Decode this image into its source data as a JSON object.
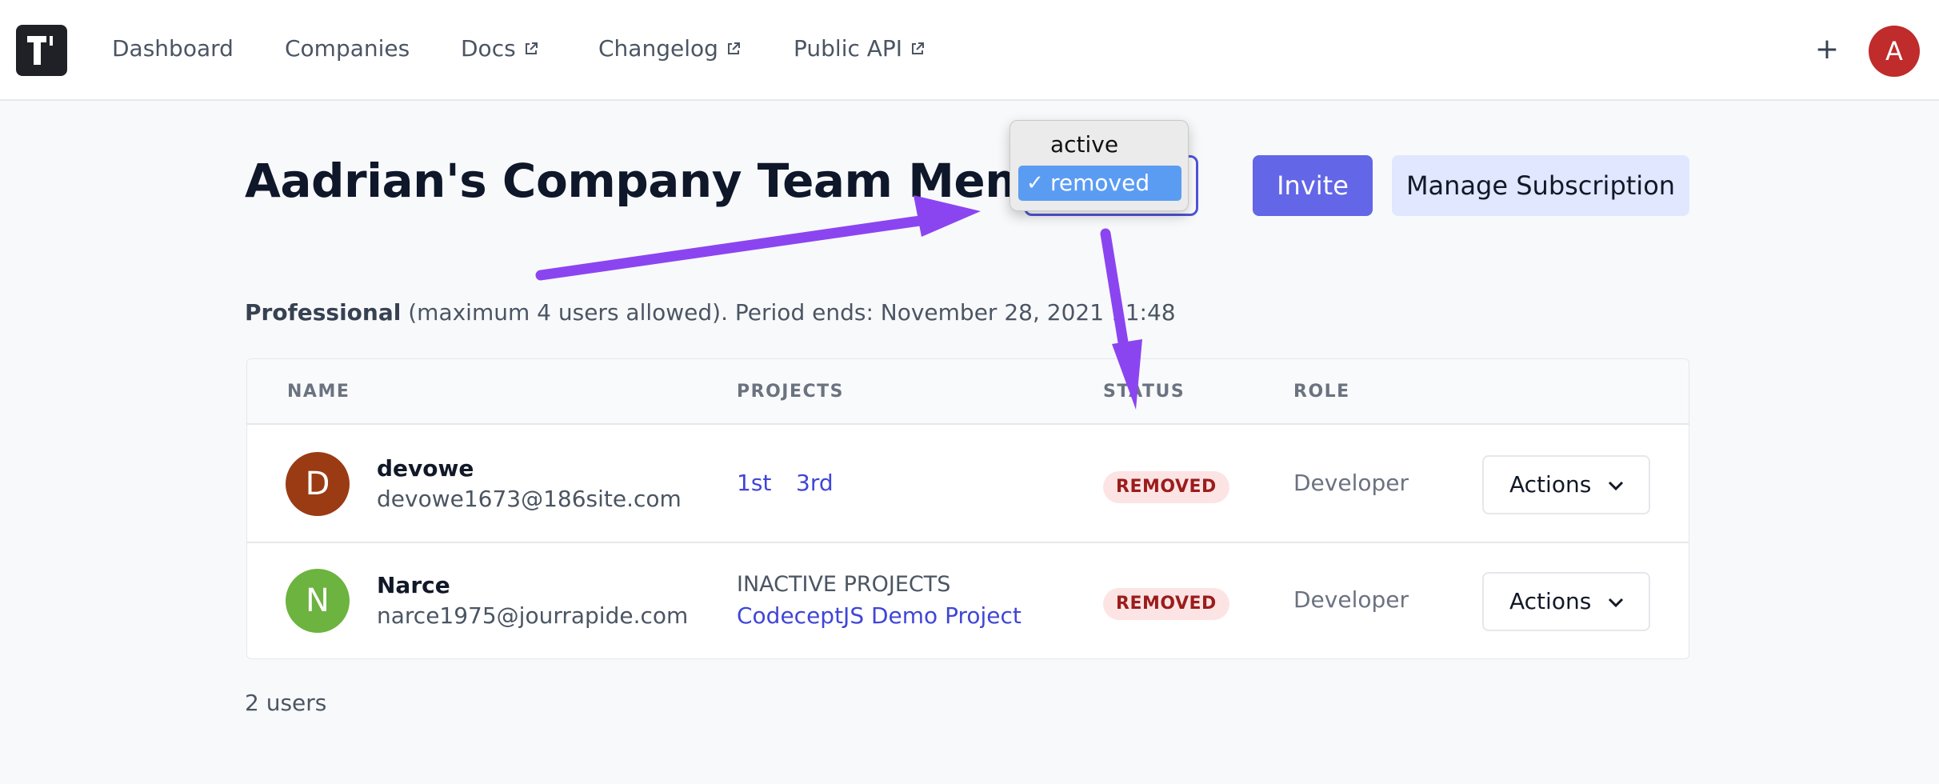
{
  "nav": {
    "items": [
      {
        "label": "Dashboard",
        "external": false
      },
      {
        "label": "Companies",
        "external": false
      },
      {
        "label": "Docs",
        "external": true
      },
      {
        "label": "Changelog",
        "external": true
      },
      {
        "label": "Public API",
        "external": true
      }
    ],
    "plus_label": "+",
    "avatar_initial": "A",
    "avatar_color": "#c02b2b",
    "logo_icon": "testomatio-logo"
  },
  "page": {
    "title": "Aadrian's Company Team Members",
    "status_select": {
      "options": [
        "active",
        "removed"
      ],
      "selected": "removed",
      "check_mark": "✓"
    },
    "invite_label": "Invite",
    "manage_label": "Manage Subscription",
    "plan": {
      "name": "Professional",
      "details": "(maximum 4 users allowed). Period ends: November 28, 2021 11:48"
    }
  },
  "table": {
    "headers": [
      "NAME",
      "PROJECTS",
      "STATUS",
      "ROLE"
    ],
    "rows": [
      {
        "initial": "D",
        "avatar_color": "#9a3b14",
        "name": "devowe",
        "email": "devowe1673@186site.com",
        "projects": [
          "1st",
          "3rd"
        ],
        "status": "REMOVED",
        "role": "Developer",
        "actions_label": "Actions"
      },
      {
        "initial": "N",
        "avatar_color": "#6cb33f",
        "name": "Narce",
        "email": "narce1975@jourrapide.com",
        "inactive_label": "INACTIVE PROJECTS",
        "inactive_project": "CodeceptJS Demo Project",
        "status": "REMOVED",
        "role": "Developer",
        "actions_label": "Actions"
      }
    ]
  },
  "footer": {
    "count": "2 users"
  },
  "colors": {
    "accent": "#6366e6",
    "annotation_arrow": "#8b45f0",
    "removed_badge_bg": "#fde4e4",
    "removed_badge_text": "#9b1c1c"
  }
}
